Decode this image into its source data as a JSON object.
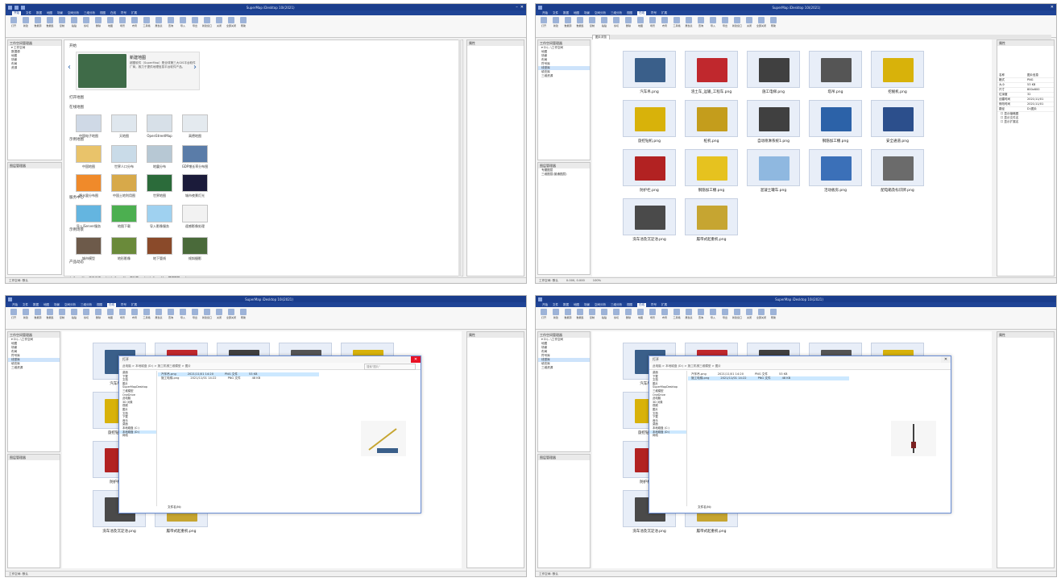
{
  "app": {
    "title": "SuperMap iDesktop 10i(2021)",
    "menu_tabs": [
      "开始",
      "文件",
      "数据",
      "地图",
      "场景",
      "空间分析",
      "三维分析",
      "视图",
      "在线",
      "符号",
      "扩展"
    ],
    "ribbon_buttons": [
      "打开",
      "新建",
      "数据源",
      "数据集",
      "复制",
      "粘贴",
      "剪切",
      "删除",
      "地图",
      "场景",
      "布局",
      "工具箱",
      "属性表",
      "查询",
      "导入",
      "导出",
      "新建窗口",
      "关闭",
      "全部关闭",
      "帮助"
    ]
  },
  "workspace": {
    "panel_title": "工作空间管理器",
    "tree": [
      "工作空间",
      "数据源",
      "地图",
      "场景",
      "布局",
      "资源"
    ],
    "tree_sub": [
      "D:\\...\\工作空间",
      "地图",
      "场景",
      "布局",
      "符号库",
      "线型库",
      "填充库",
      "三维资源"
    ],
    "layer_panel_title": "图层管理器",
    "layer_items": [
      "专题图层",
      "三维图层(普通图层)"
    ]
  },
  "start_page": {
    "section1": "开始",
    "banner_title": "新建地图",
    "banner_text": "超图软件（SuperMap）是全球第三大GIS平台软件厂商，致力于提供地理信息平台软件产品。",
    "section2": "打开地图",
    "section3": "在线地图",
    "online_maps": [
      "中国电子地图",
      "天地图",
      "OpenStreetMap",
      "高德地图"
    ],
    "section4": "示例地图",
    "sample_maps": [
      "中国地图",
      "世界人口分布",
      "地震分布",
      "GDP增长率分布图",
      "降水量分布图",
      "中国土地利用图",
      "世界地图",
      "城市夜景灯光"
    ],
    "section5": "服务中心",
    "service_items": [
      "导入iServer服务",
      "地图下载",
      "导入影像服务",
      "遥感影像处理"
    ],
    "section6": "示例场景",
    "scene_items": [
      "城市模型",
      "地形影像",
      "地下管线",
      "倾斜摄影"
    ],
    "section7": "产品动态",
    "taskbar": [
      "SuperMap 产品介绍...",
      "SuperMap 新功能...",
      "SuperMap 视频教程..."
    ]
  },
  "image_browser": {
    "tab_label": "图片浏览",
    "images": [
      {
        "name": "汽车吊.png",
        "color": "#3a5f8a"
      },
      {
        "name": "渣土车_运输_工程车.png",
        "color": "#c0282d"
      },
      {
        "name": "施工电梯.png",
        "color": "#404040"
      },
      {
        "name": "塔吊.png",
        "color": "#555555"
      },
      {
        "name": "挖掘机.png",
        "color": "#d8b20a"
      },
      {
        "name": "旋挖钻机.png",
        "color": "#d8b20a"
      },
      {
        "name": "桩机.png",
        "color": "#c49d1c"
      },
      {
        "name": "自动喷淋系统1.png",
        "color": "#404040"
      },
      {
        "name": "钢筋加工棚.png",
        "color": "#2c62a8"
      },
      {
        "name": "安全通道.png",
        "color": "#2c4f8c"
      },
      {
        "name": "防护栏.png",
        "color": "#b22222"
      },
      {
        "name": "钢筋加工棚.png",
        "color": "#e6c21f"
      },
      {
        "name": "混凝土罐车.png",
        "color": "#8fb8e0"
      },
      {
        "name": "活动板房.png",
        "color": "#3b70b8"
      },
      {
        "name": "配电箱及标识牌.png",
        "color": "#6b6b6b"
      },
      {
        "name": "洗车池及沉淀池.png",
        "color": "#4a4a4a"
      },
      {
        "name": "履带式起重机.png",
        "color": "#c6a531"
      }
    ]
  },
  "properties": {
    "panel_title": "属性",
    "rows": [
      [
        "名称",
        "图片信息"
      ],
      [
        "格式",
        "PNG"
      ],
      [
        "大小",
        "53 KB"
      ],
      [
        "尺寸",
        "800x600"
      ],
      [
        "位深度",
        "32"
      ],
      [
        "创建时间",
        "2021/11/01"
      ],
      [
        "修改时间",
        "2021/11/01"
      ],
      [
        "路径",
        "D:\\图片"
      ]
    ],
    "checkboxes": [
      "显示缩略图",
      "显示文件名",
      "显示扩展名"
    ]
  },
  "dialog": {
    "title": "打开",
    "path": "此电脑 > 本地磁盘 (D:) > 施工机械三维模型 > 图片",
    "search_placeholder": "搜索\"图片\"",
    "tree": [
      "桌面",
      "下载",
      "文档",
      "图片",
      "SuperMapDesktop",
      "三维模型",
      "OneDrive",
      "此电脑",
      "3D 对象",
      "视频",
      "图片",
      "文档",
      "下载",
      "音乐",
      "桌面",
      "本地磁盘 (C:)",
      "本地磁盘 (D:)",
      "网络"
    ],
    "files": [
      {
        "name": "汽车吊.png",
        "date": "2021/11/01 14:20",
        "type": "PNG 文件",
        "size": "53 KB"
      },
      {
        "name": "施工电梯.png",
        "date": "2021/11/01 14:22",
        "type": "PNG 文件",
        "size": "48 KB"
      }
    ],
    "file_label": "文件名(N):",
    "open_btn": "打开(O)",
    "cancel_btn": "取消"
  },
  "status": {
    "left": "工作空间: 默认",
    "coord": "0.000, 0.000",
    "zoom": "100%"
  }
}
